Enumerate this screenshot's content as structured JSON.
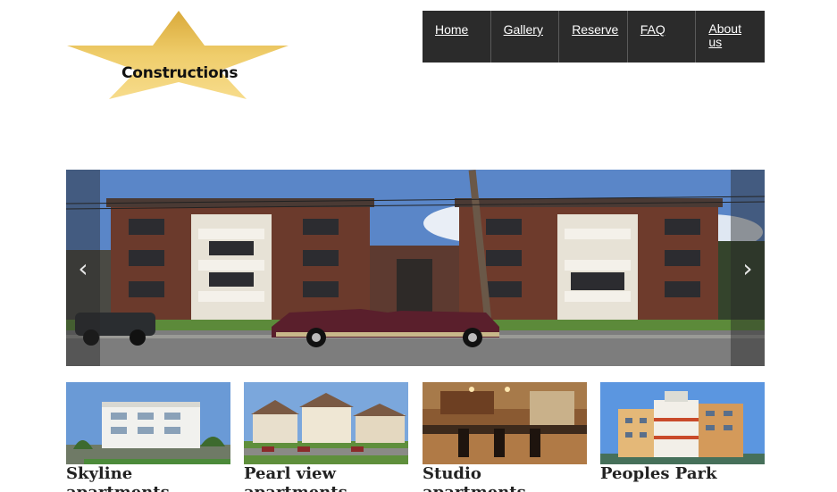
{
  "logo": {
    "text": "Constructions"
  },
  "nav": {
    "items": [
      {
        "label": "Home"
      },
      {
        "label": "Gallery"
      },
      {
        "label": "Reserve"
      },
      {
        "label": "FAQ"
      },
      {
        "label": "About us"
      }
    ]
  },
  "carousel": {
    "prev_glyph": "‹",
    "next_glyph": "›"
  },
  "listings": [
    {
      "title": "Skyline apartments"
    },
    {
      "title": "Pearl view apartments"
    },
    {
      "title": "Studio apartments"
    },
    {
      "title": "Peoples Park"
    }
  ],
  "colors": {
    "nav_bg": "#2b2b2b",
    "star_gold": "#e8bf55"
  },
  "icons": {
    "prev": "chevron-left-icon",
    "next": "chevron-right-icon"
  }
}
